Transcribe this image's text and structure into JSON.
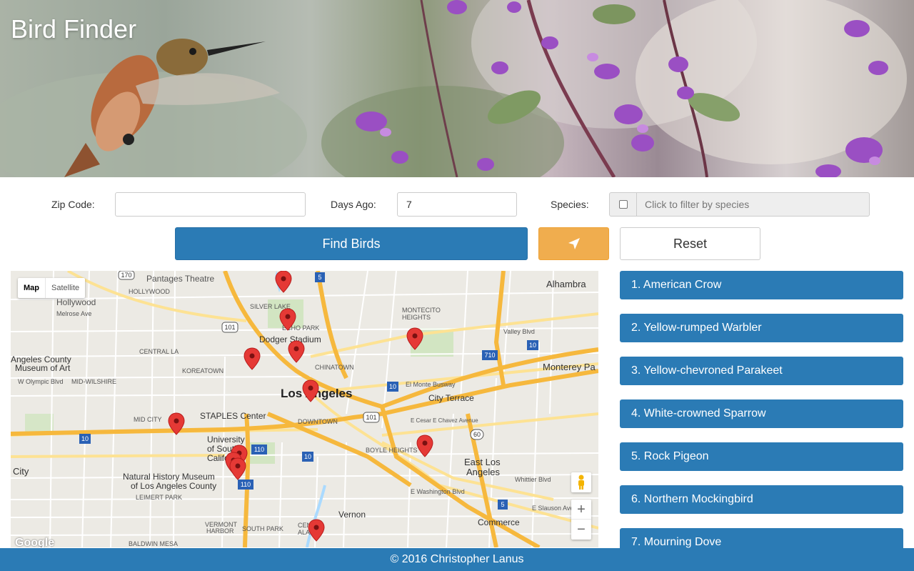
{
  "app": {
    "title": "Bird Finder"
  },
  "form": {
    "zip_label": "Zip Code:",
    "zip_value": "",
    "days_label": "Days Ago:",
    "days_value": "7",
    "species_label": "Species:",
    "species_placeholder": "Click to filter by species"
  },
  "buttons": {
    "find_label": "Find Birds",
    "locate_icon": "location-arrow-icon",
    "reset_label": "Reset"
  },
  "map": {
    "type_map": "Map",
    "type_satellite": "Satellite",
    "zoom_in": "+",
    "zoom_out": "−",
    "logo": "Google",
    "labels": {
      "pantages": "Pantages Theatre",
      "hollywood_caps": "HOLLYWOOD",
      "hollywood": "Hollywood",
      "melrose": "Melrose Ave",
      "silver_lake": "SILVER LAKE",
      "echo_park": "ECHO PARK",
      "dodger": "Dodger Stadium",
      "montecito": "MONTECITO",
      "heights": "HEIGHTS",
      "alhambra": "Alhambra",
      "valley_blvd": "Valley Blvd",
      "central_la": "CENTRAL LA",
      "angeles_county": "Angeles County",
      "museum_art": "Museum of Art",
      "koreatown": "KOREATOWN",
      "wilshire": "MID-WILSHIRE",
      "olympic": "W Olympic Blvd",
      "chinatown": "CHINATOWN",
      "los_angeles": "Los Angeles",
      "monterey": "Monterey Pa",
      "city_terrace": "City Terrace",
      "staples": "STAPLES Center",
      "downtown": "DOWNTOWN",
      "mid_city": "MID CITY",
      "usc1": "University",
      "usc2": "of South",
      "usc3": "Califo",
      "boyle": "BOYLE HEIGHTS",
      "east_la1": "East Los",
      "east_la2": "Angeles",
      "city": "City",
      "nhm1": "Natural History Museum",
      "nhm2": "of Los Angeles County",
      "leimert": "LEIMERT PARK",
      "vernon": "Vernon",
      "vermont1": "VERMONT",
      "vermont2": "HARBOR",
      "south_park": "SOUTH PARK",
      "commerce": "Commerce",
      "central_al1": "CEN",
      "central_al2": "ALAM",
      "baldwin_mesa": "BALDWIN MESA",
      "el_monte": "El Monte Busway",
      "cesar": "E Cesar E Chavez Avenue",
      "whittier": "Whittier Blvd",
      "washington": "E Washington Blvd",
      "slauson": "E Slauson Ave"
    }
  },
  "birds": [
    "1. American Crow",
    "2. Yellow-rumped Warbler",
    "3. Yellow-chevroned Parakeet",
    "4. White-crowned Sparrow",
    "5. Rock Pigeon",
    "6. Northern Mockingbird",
    "7. Mourning Dove"
  ],
  "footer": {
    "text": "© 2016 Christopher Lanus"
  },
  "colors": {
    "primary": "#2b7bb5",
    "warning": "#f0ad4e",
    "marker": "#e53935"
  }
}
